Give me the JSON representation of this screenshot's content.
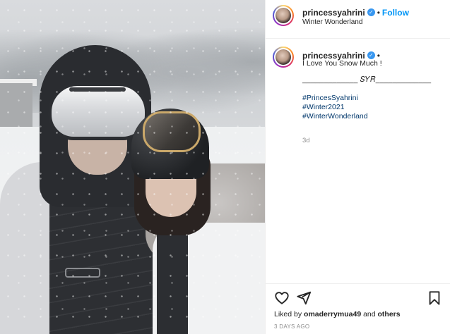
{
  "header": {
    "username": "princessyahrini",
    "dot": "•",
    "follow_label": "Follow",
    "location": "Winter Wonderland"
  },
  "caption": {
    "username": "princessyahrini",
    "dot": "•",
    "text": "I Love You Snow Much !",
    "signature": "_____________ 𝑆𝑌𝑅_____________",
    "hashtags": [
      "#PrincesSyahrini",
      "#Winter2021",
      "#WinterWonderland"
    ],
    "time_ago": "3d"
  },
  "actions": {
    "icons": [
      "heart-icon",
      "share-icon",
      "bookmark-icon"
    ],
    "liked_by_prefix": "Liked by ",
    "liked_by_user": "omaderrymua49",
    "liked_by_suffix": " and ",
    "liked_by_others": "others",
    "date": "3 DAYS AGO"
  },
  "colors": {
    "link": "#0095f6",
    "hashtag": "#00376b",
    "verified": "#3897f0",
    "muted": "#8e8e8e"
  }
}
